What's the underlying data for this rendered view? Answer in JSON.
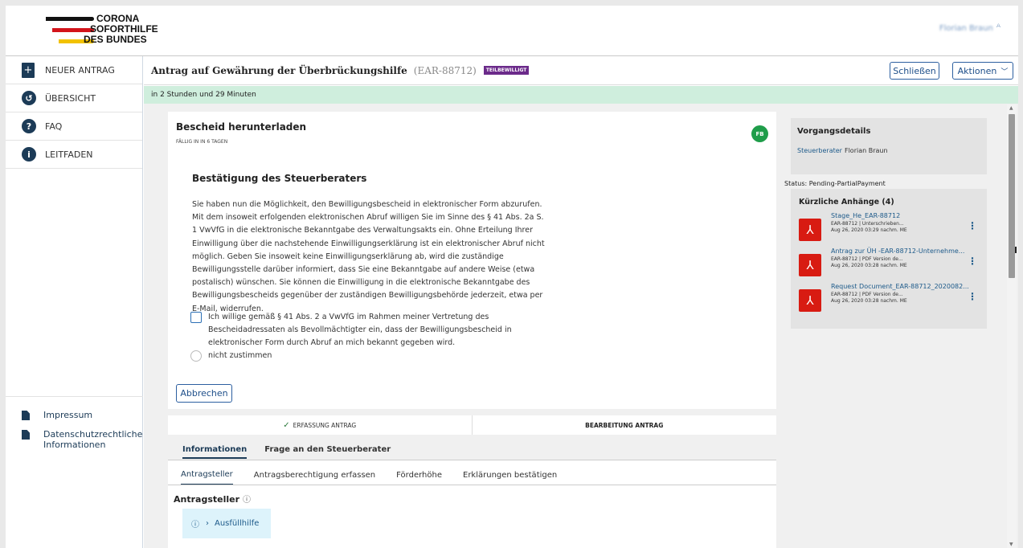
{
  "brand": {
    "line1": "CORONA",
    "line2": "SOFORTHILFE",
    "line3": "DES BUNDES"
  },
  "user": {
    "name": "Florian Braun",
    "icon": "person-icon"
  },
  "sidebar": {
    "items": [
      {
        "label": "NEUER ANTRAG",
        "icon": "new-document-icon"
      },
      {
        "label": "ÜBERSICHT",
        "icon": "history-icon"
      },
      {
        "label": "FAQ",
        "icon": "question-icon"
      },
      {
        "label": "LEITFADEN",
        "icon": "info-icon"
      }
    ],
    "footer": [
      {
        "label": "Impressum",
        "icon": "document-icon"
      },
      {
        "label": "Datenschutzrechtliche Informationen",
        "icon": "document-icon"
      }
    ]
  },
  "header": {
    "title": "Antrag auf Gewährung der Überbrückungshilfe",
    "reference": "(EAR-88712)",
    "badge": "TEILBEWILLIGT",
    "close_label": "Schließen",
    "actions_label": "Aktionen"
  },
  "timer": "in 2 Stunden und 29 Minuten",
  "task": {
    "title": "Bescheid herunterladen",
    "due": "FÄLLIG IN IN 6 TAGEN",
    "avatar": "FB",
    "heading": "Bestätigung des Steuerberaters",
    "paragraph": "Sie haben nun die Möglichkeit, den Bewilligungsbescheid in elektronischer Form abzurufen. Mit dem insoweit erfolgenden elektronischen Abruf willigen Sie im Sinne des § 41 Abs. 2a S. 1 VwVfG in die elektronische Bekanntgabe des Verwaltungsakts ein. Ohne Erteilung Ihrer Einwilligung über die nachstehende Einwilligungserklärung ist ein elektronischer Abruf nicht möglich. Geben Sie insoweit keine Einwilligungserklärung ab, wird die zuständige Bewilligungsstelle darüber informiert, dass Sie eine Bekanntgabe auf andere Weise (etwa postalisch) wünschen. Sie können die Einwilligung in die elektronische Bekanntgabe des Bewilligungsbescheids gegenüber der zuständigen Bewilligungsbehörde jederzeit, etwa per E-Mail, widerrufen.",
    "consent_option": "Ich willige gemäß § 41 Abs. 2 a VwVfG im Rahmen meiner Vertretung des Bescheidadressaten als Bevollmächtigter ein, dass der Bewilligungsbescheid in elektronischer Form durch Abruf an mich bekannt gegeben wird.",
    "decline_option": "nicht zustimmen",
    "cancel_label": "Abbrechen"
  },
  "steps": [
    {
      "label": "ERFASSUNG ANTRAG",
      "done": true
    },
    {
      "label": "BEARBEITUNG ANTRAG",
      "done": false
    }
  ],
  "tabs": [
    "Informationen",
    "Frage an den Steuerberater"
  ],
  "subtabs": [
    "Antragsteller",
    "Antragsberechtigung erfassen",
    "Förderhöhe",
    "Erklärungen bestätigen"
  ],
  "section": {
    "title": "Antragsteller",
    "help_label": "Ausfüllhilfe"
  },
  "details": {
    "title": "Vorgangsdetails",
    "role": "Steuerberater",
    "name": "Florian Braun",
    "status": "Status: Pending-PartialPayment"
  },
  "attachments": {
    "title": "Kürzliche Anhänge (4)",
    "items": [
      {
        "name": "Stage_He_EAR-88712",
        "meta1": "EAR-88712 | Unterschrieben...",
        "meta2": "Aug 26, 2020 03:29 nachm. ME"
      },
      {
        "name": "Antrag zur ÜH -EAR-88712-Unternehme...",
        "meta1": "EAR-88712 | PDF Version de...",
        "meta2": "Aug 26, 2020 03:28 nachm. ME"
      },
      {
        "name": "Request Document_EAR-88712_2020082...",
        "meta1": "EAR-88712 | PDF Version de...",
        "meta2": "Aug 26, 2020 03:28 nachm. ME"
      }
    ]
  },
  "colors": {
    "primary": "#1c3b57",
    "accent": "#2c5fa0",
    "badge": "#6b2a8a",
    "timer_bg": "#cfeedd",
    "pdf": "#d81b12"
  }
}
